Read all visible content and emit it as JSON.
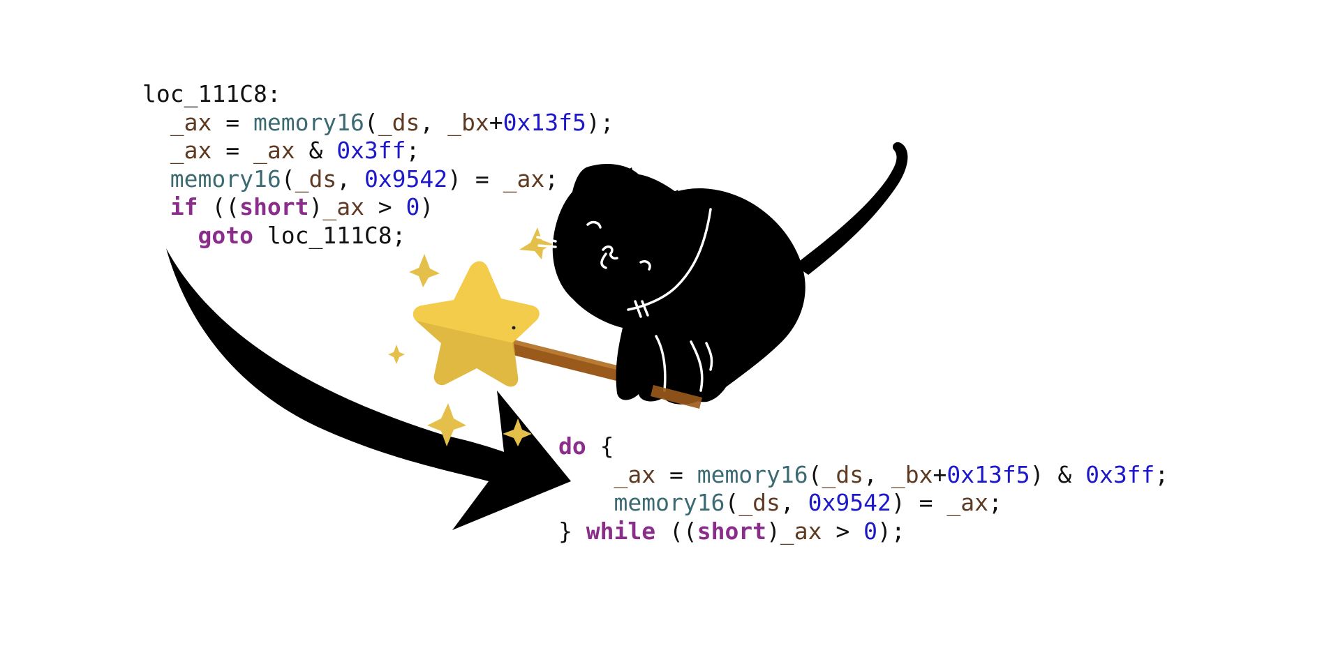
{
  "before_code": {
    "label": "loc_111C8",
    "lines": [
      [
        "loc_111C8:"
      ],
      [
        "  ",
        "_ax",
        " = ",
        "memory16",
        "(",
        "_ds",
        ", ",
        "_bx",
        "+",
        "0x13f5",
        ");"
      ],
      [
        "  ",
        "_ax",
        " = ",
        "_ax",
        " & ",
        "0x3ff",
        ";"
      ],
      [
        "  ",
        "memory16",
        "(",
        "_ds",
        ", ",
        "0x9542",
        ") = ",
        "_ax",
        ";"
      ],
      [
        "  ",
        "if",
        " ((",
        "short",
        ")",
        "_ax",
        " > ",
        "0",
        ")"
      ],
      [
        "    ",
        "goto",
        " loc_111C8;"
      ]
    ]
  },
  "after_code": {
    "lines": [
      [
        "do",
        " {"
      ],
      [
        "    ",
        "_ax",
        " = ",
        "memory16",
        "(",
        "_ds",
        ", ",
        "_bx",
        "+",
        "0x13f5",
        ") & ",
        "0x3ff",
        ";"
      ],
      [
        "    ",
        "memory16",
        "(",
        "_ds",
        ", ",
        "0x9542",
        ") = ",
        "_ax",
        ";"
      ],
      [
        "} ",
        "while",
        " ((",
        "short",
        ")",
        "_ax",
        " > ",
        "0",
        ");"
      ]
    ]
  },
  "colors": {
    "keyword": "#8b2e8b",
    "function": "#3c6a73",
    "variable": "#5e3a22",
    "number": "#1d18c9",
    "text": "#111111",
    "star": "#f2cc4a",
    "wand": "#9a5a1c",
    "cat": "#000000"
  },
  "icons": [
    "cat-illustration",
    "magic-wand-icon",
    "sparkle-icon",
    "curved-arrow"
  ]
}
